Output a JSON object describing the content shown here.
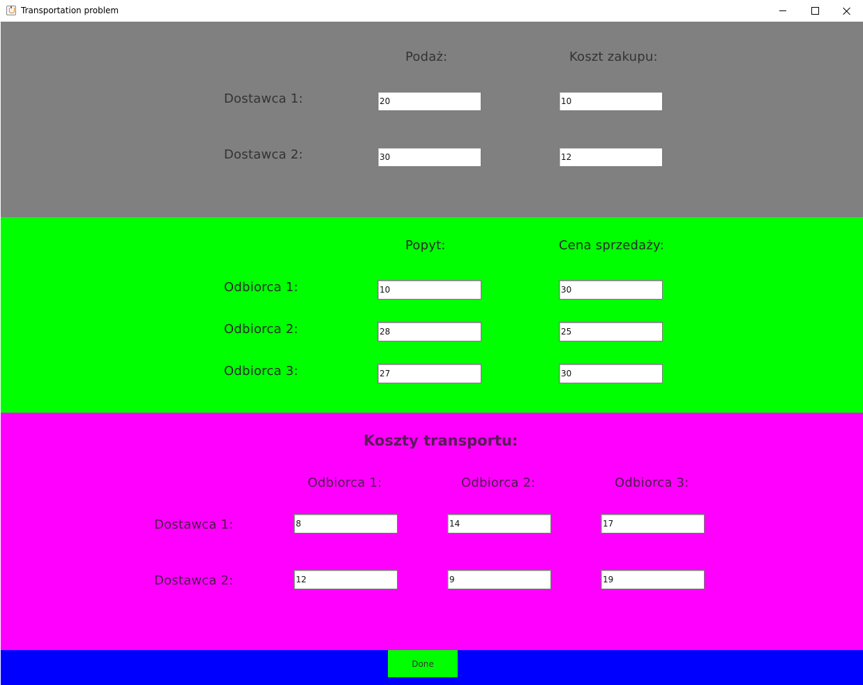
{
  "window": {
    "title": "Transportation problem"
  },
  "supply": {
    "header_supply": "Podaż:",
    "header_cost": "Koszt zakupu:",
    "rows": [
      {
        "label": "Dostawca 1:",
        "supply": "20",
        "cost": "10"
      },
      {
        "label": "Dostawca 2:",
        "supply": "30",
        "cost": "12"
      }
    ]
  },
  "demand": {
    "header_demand": "Popyt:",
    "header_price": "Cena sprzedaży:",
    "rows": [
      {
        "label": "Odbiorca 1:",
        "demand": "10",
        "price": "30"
      },
      {
        "label": "Odbiorca 2:",
        "demand": "28",
        "price": "25"
      },
      {
        "label": "Odbiorca 3:",
        "demand": "27",
        "price": "30"
      }
    ]
  },
  "transport": {
    "title": "Koszty transportu:",
    "columns": [
      "Odbiorca 1:",
      "Odbiorca 2:",
      "Odbiorca 3:"
    ],
    "rows": [
      {
        "label": "Dostawca 1:",
        "values": [
          "8",
          "14",
          "17"
        ]
      },
      {
        "label": "Dostawca 2:",
        "values": [
          "12",
          "9",
          "19"
        ]
      }
    ]
  },
  "actions": {
    "done_label": "Done"
  },
  "colors": {
    "supply_bg": "#808080",
    "demand_bg": "#00ff00",
    "transport_bg": "#ff00ff",
    "bottom_bg": "#0000ff",
    "done_button": "#00ff00"
  },
  "icons": {
    "app": "java-coffee-icon",
    "minimize": "minimize-icon",
    "maximize": "maximize-icon",
    "close": "close-icon"
  }
}
